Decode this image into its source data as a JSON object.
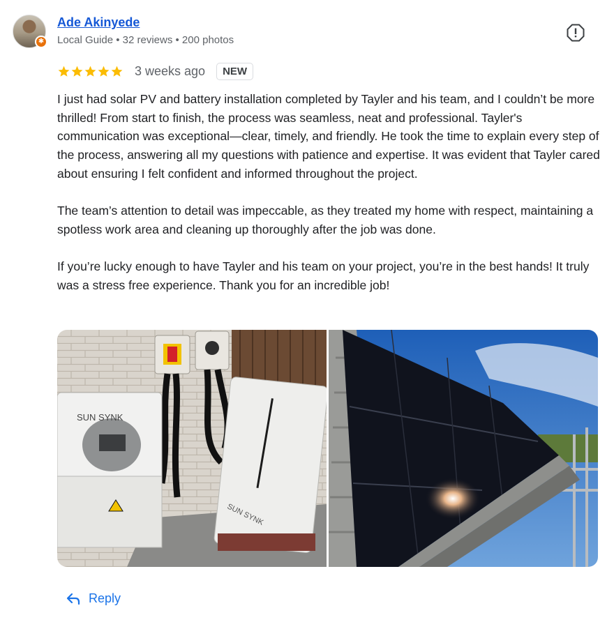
{
  "review": {
    "author": {
      "name": "Ade Akinyede",
      "meta": "Local Guide • 32 reviews • 200 photos"
    },
    "rating": 5,
    "time": "3 weeks ago",
    "badge": "NEW",
    "paragraphs": [
      "I just had solar PV and battery installation completed by Tayler and his team, and I couldn’t be more thrilled! From start to finish, the process was seamless, neat and professional. Tayler's communication was exceptional—clear, timely, and friendly. He took the time to explain every step of the process, answering all my questions with patience and expertise. It was evident that Tayler cared about ensuring I felt confident and informed throughout the project.",
      "The team’s attention to detail was impeccable, as they treated my home with respect, maintaining a spotless work area and cleaning up thoroughly after the job was done.",
      "If you’re lucky enough to have Tayler and his team on your project, you’re in the best hands! It truly was a stress free experience. Thank you for an incredible job!"
    ],
    "photos": {
      "inverter_brand": "SUN SYNK",
      "battery_brand": "SUN SYNK"
    },
    "reply_label": "Reply"
  },
  "colors": {
    "link": "#1558d6",
    "star": "#fbbc04",
    "reply": "#1a73e8",
    "muted": "#5f6368"
  },
  "icons": [
    "report-icon",
    "star-icon",
    "reply-arrow-icon",
    "local-guide-badge-icon"
  ]
}
